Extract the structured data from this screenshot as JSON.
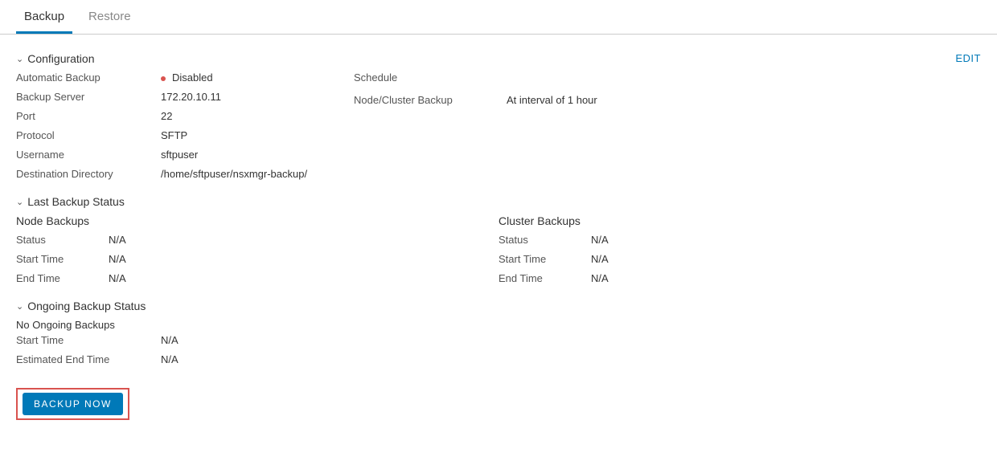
{
  "tabs": {
    "backup": "Backup",
    "restore": "Restore"
  },
  "edit_label": "EDIT",
  "sections": {
    "configuration": "Configuration",
    "last_backup": "Last Backup Status",
    "ongoing": "Ongoing Backup Status"
  },
  "config": {
    "auto_backup_label": "Automatic Backup",
    "auto_backup_value": "Disabled",
    "backup_server_label": "Backup Server",
    "backup_server_value": "172.20.10.11",
    "port_label": "Port",
    "port_value": "22",
    "protocol_label": "Protocol",
    "protocol_value": "SFTP",
    "username_label": "Username",
    "username_value": "sftpuser",
    "dest_dir_label": "Destination Directory",
    "dest_dir_value": "/home/sftpuser/nsxmgr-backup/",
    "schedule_label": "Schedule",
    "node_cluster_label": "Node/Cluster Backup",
    "node_cluster_value": "At interval of 1 hour"
  },
  "last_backup": {
    "node_title": "Node Backups",
    "cluster_title": "Cluster Backups",
    "status_label": "Status",
    "start_label": "Start Time",
    "end_label": "End Time",
    "node_status": "N/A",
    "node_start": "N/A",
    "node_end": "N/A",
    "cluster_status": "N/A",
    "cluster_start": "N/A",
    "cluster_end": "N/A"
  },
  "ongoing": {
    "none_msg": "No Ongoing Backups",
    "start_label": "Start Time",
    "est_end_label": "Estimated End Time",
    "start_value": "N/A",
    "est_end_value": "N/A"
  },
  "backup_now_label": "BACKUP NOW"
}
